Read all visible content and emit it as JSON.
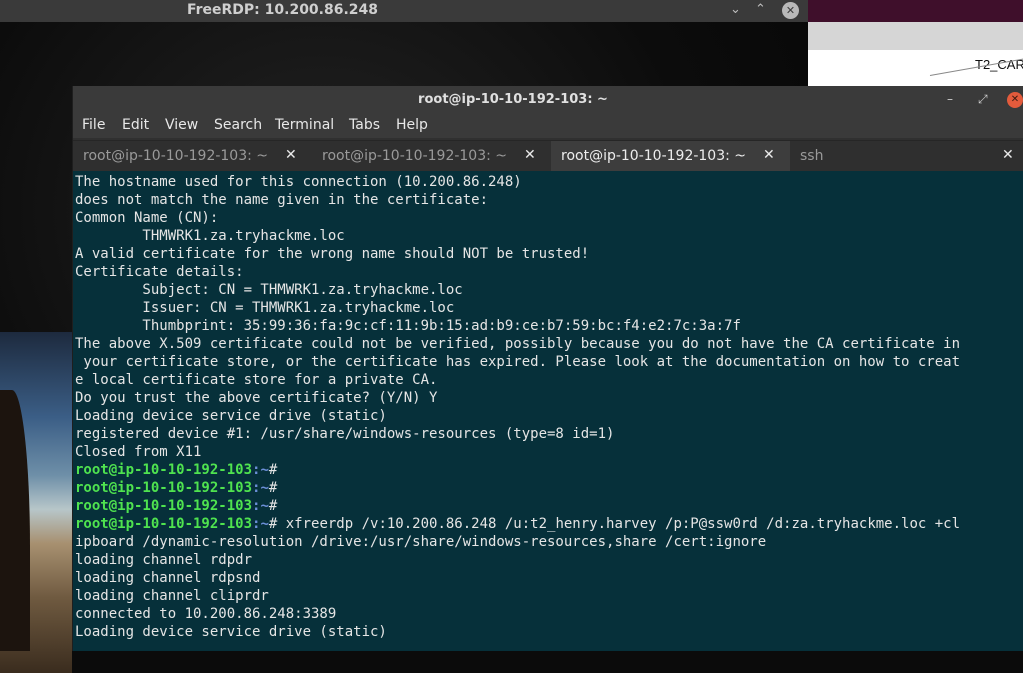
{
  "rdp": {
    "title": "FreeRDP: 10.200.86.248",
    "minimize": "⌄",
    "restore": "⌃",
    "close": "✕"
  },
  "desktop": {
    "right_label": "T2_CAR"
  },
  "terminal": {
    "title": "root@ip-10-10-192-103: ~",
    "minimize": "–",
    "restore": "⤢",
    "close": "✕",
    "menu": [
      "File",
      "Edit",
      "View",
      "Search",
      "Terminal",
      "Tabs",
      "Help"
    ],
    "tabs": [
      {
        "label": "root@ip-10-10-192-103: ~",
        "close": "✕"
      },
      {
        "label": "root@ip-10-10-192-103: ~",
        "close": "✕"
      },
      {
        "label": "root@ip-10-10-192-103: ~",
        "close": "✕"
      },
      {
        "label": "ssh",
        "close": "✕"
      }
    ],
    "active_tab": 2,
    "lines": [
      {
        "text": "The hostname used for this connection (10.200.86.248)"
      },
      {
        "text": "does not match the name given in the certificate:"
      },
      {
        "text": "Common Name (CN):"
      },
      {
        "text": "        THMWRK1.za.tryhackme.loc"
      },
      {
        "text": "A valid certificate for the wrong name should NOT be trusted!"
      },
      {
        "text": "Certificate details:"
      },
      {
        "text": "        Subject: CN = THMWRK1.za.tryhackme.loc"
      },
      {
        "text": "        Issuer: CN = THMWRK1.za.tryhackme.loc"
      },
      {
        "text": "        Thumbprint: 35:99:36:fa:9c:cf:11:9b:15:ad:b9:ce:b7:59:bc:f4:e2:7c:3a:7f"
      },
      {
        "text": "The above X.509 certificate could not be verified, possibly because you do not have the CA certificate in"
      },
      {
        "text": " your certificate store, or the certificate has expired. Please look at the documentation on how to creat"
      },
      {
        "text": "e local certificate store for a private CA."
      },
      {
        "text": "Do you trust the above certificate? (Y/N) Y"
      },
      {
        "text": "Loading device service drive (static)"
      },
      {
        "text": "registered device #1: /usr/share/windows-resources (type=8 id=1)"
      },
      {
        "text": "Closed from X11"
      },
      {
        "prompt_user": "root@ip-10-10-192-103",
        "prompt_path": ":~",
        "text": "#"
      },
      {
        "prompt_user": "root@ip-10-10-192-103",
        "prompt_path": ":~",
        "text": "#"
      },
      {
        "prompt_user": "root@ip-10-10-192-103",
        "prompt_path": ":~",
        "text": "#"
      },
      {
        "prompt_user": "root@ip-10-10-192-103",
        "prompt_path": ":~",
        "text": "# xfreerdp /v:10.200.86.248 /u:t2_henry.harvey /p:P@ssw0rd /d:za.tryhackme.loc +cl"
      },
      {
        "text": "ipboard /dynamic-resolution /drive:/usr/share/windows-resources,share /cert:ignore"
      },
      {
        "text": "loading channel rdpdr"
      },
      {
        "text": "loading channel rdpsnd"
      },
      {
        "text": "loading channel cliprdr"
      },
      {
        "text": "connected to 10.200.86.248:3389"
      },
      {
        "text": "Loading device service drive (static)"
      }
    ]
  }
}
